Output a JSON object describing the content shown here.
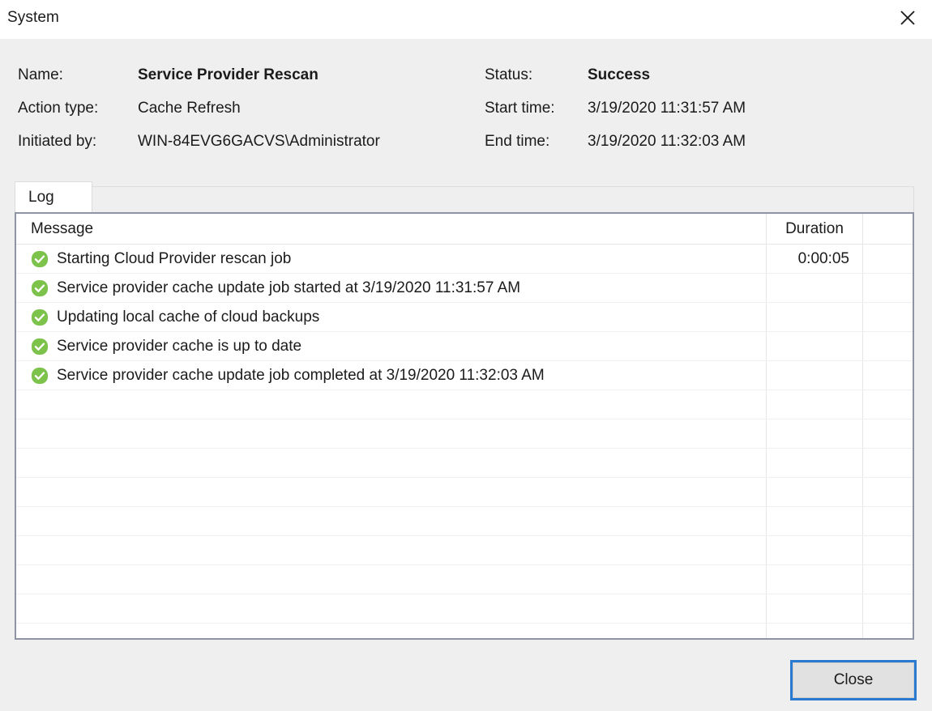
{
  "window": {
    "title": "System",
    "close_icon": "close-x-icon"
  },
  "info": {
    "rows_left": [
      {
        "label": "Name:",
        "value": "Service Provider Rescan",
        "bold": true
      },
      {
        "label": "Action type:",
        "value": "Cache Refresh",
        "bold": false
      },
      {
        "label": "Initiated by:",
        "value": "WIN-84EVG6GACVS\\Administrator",
        "bold": false
      }
    ],
    "rows_right": [
      {
        "label": "Status:",
        "value": "Success",
        "bold": true
      },
      {
        "label": "Start time:",
        "value": "3/19/2020 11:31:57 AM",
        "bold": false
      },
      {
        "label": "End time:",
        "value": "3/19/2020 11:32:03 AM",
        "bold": false
      }
    ]
  },
  "tabs": [
    {
      "label": "Log",
      "active": true
    }
  ],
  "log_table": {
    "columns": [
      "Message",
      "Duration"
    ],
    "rows": [
      {
        "icon": "success-check-icon",
        "message": "Starting Cloud Provider rescan job",
        "duration": "0:00:05"
      },
      {
        "icon": "success-check-icon",
        "message": "Service  provider cache update job started at 3/19/2020 11:31:57 AM",
        "duration": ""
      },
      {
        "icon": "success-check-icon",
        "message": "Updating local cache of cloud backups",
        "duration": ""
      },
      {
        "icon": "success-check-icon",
        "message": "Service provider cache is up to date",
        "duration": ""
      },
      {
        "icon": "success-check-icon",
        "message": "Service provider cache update job completed at 3/19/2020 11:32:03 AM",
        "duration": ""
      }
    ],
    "empty_row_count": 9
  },
  "footer": {
    "close_label": "Close"
  },
  "colors": {
    "success_green": "#7cc24b",
    "focus_blue": "#2a7ad2",
    "dialog_background": "#efefef",
    "panel_border": "#8e94a3"
  }
}
